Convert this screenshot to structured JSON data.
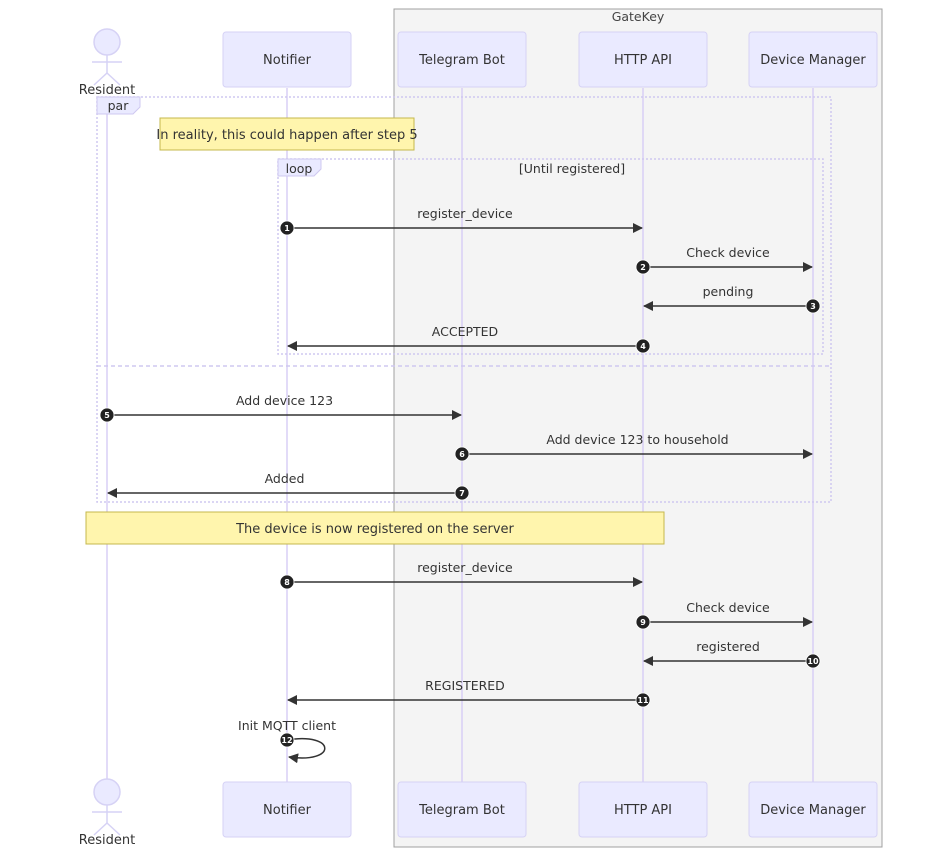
{
  "colors": {
    "actor_fill": "#eaeaff",
    "actor_stroke": "#d6d2f5",
    "lifeline": "#d8cff5",
    "box_fill": "#f4f4f4",
    "box_stroke": "#a0a0a0",
    "message": "#333333",
    "note_fill": "#fff5ad",
    "note_stroke": "#c4b84d",
    "frame_stroke": "#cfc8f0",
    "seq_fill": "#222222"
  },
  "box": {
    "title": "GateKey"
  },
  "participants": [
    {
      "id": "resident",
      "label": "Resident",
      "type": "actor"
    },
    {
      "id": "notifier",
      "label": "Notifier",
      "type": "participant"
    },
    {
      "id": "telegram",
      "label": "Telegram Bot",
      "type": "participant"
    },
    {
      "id": "api",
      "label": "HTTP API",
      "type": "participant"
    },
    {
      "id": "device",
      "label": "Device Manager",
      "type": "participant"
    }
  ],
  "frames": {
    "par": {
      "label": "par"
    },
    "loop": {
      "label": "loop",
      "condition": "[Until registered]"
    }
  },
  "notes": [
    {
      "text": "In reality, this could happen after step 5"
    },
    {
      "text": "The device is now registered on the server"
    }
  ],
  "messages": [
    {
      "n": "1",
      "from": "notifier",
      "to": "api",
      "text": "register_device"
    },
    {
      "n": "2",
      "from": "api",
      "to": "device",
      "text": "Check device"
    },
    {
      "n": "3",
      "from": "device",
      "to": "api",
      "text": "pending"
    },
    {
      "n": "4",
      "from": "api",
      "to": "notifier",
      "text": "ACCEPTED"
    },
    {
      "n": "5",
      "from": "resident",
      "to": "telegram",
      "text": "Add device 123"
    },
    {
      "n": "6",
      "from": "telegram",
      "to": "device",
      "text": "Add device 123 to household"
    },
    {
      "n": "7",
      "from": "telegram",
      "to": "resident",
      "text": "Added"
    },
    {
      "n": "8",
      "from": "notifier",
      "to": "api",
      "text": "register_device"
    },
    {
      "n": "9",
      "from": "api",
      "to": "device",
      "text": "Check device"
    },
    {
      "n": "10",
      "from": "device",
      "to": "api",
      "text": "registered"
    },
    {
      "n": "11",
      "from": "api",
      "to": "notifier",
      "text": "REGISTERED"
    },
    {
      "n": "12",
      "from": "notifier",
      "to": "notifier",
      "text": "Init MQTT client"
    }
  ]
}
